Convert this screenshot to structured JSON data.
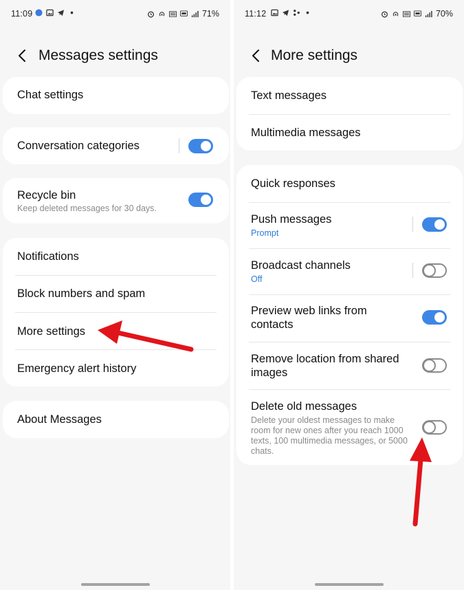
{
  "left": {
    "status": {
      "time": "11:09",
      "battery": "71%"
    },
    "title": "Messages settings",
    "items": {
      "chat": "Chat settings",
      "conversation_categories": "Conversation categories",
      "recycle_bin": "Recycle bin",
      "recycle_bin_sub": "Keep deleted messages for 30 days.",
      "notifications": "Notifications",
      "block": "Block numbers and spam",
      "more": "More settings",
      "emergency": "Emergency alert history",
      "about": "About Messages"
    },
    "toggles": {
      "conversation_categories": true,
      "recycle_bin": true
    }
  },
  "right": {
    "status": {
      "time": "11:12",
      "battery": "70%"
    },
    "title": "More settings",
    "items": {
      "text": "Text messages",
      "multimedia": "Multimedia messages",
      "quick": "Quick responses",
      "push": "Push messages",
      "push_sub": "Prompt",
      "broadcast": "Broadcast channels",
      "broadcast_sub": "Off",
      "preview": "Preview web links from contacts",
      "remove_loc": "Remove location from shared images",
      "delete_old": "Delete old messages",
      "delete_old_sub": "Delete your oldest messages to make room for new ones after you reach 1000 texts, 100 multimedia messages, or 5000 chats."
    },
    "toggles": {
      "push": true,
      "broadcast": false,
      "preview": true,
      "remove_loc": false,
      "delete_old": false
    }
  },
  "colors": {
    "accent": "#3e86e6",
    "arrow": "#e0151b",
    "background": "#f6f6f6"
  }
}
